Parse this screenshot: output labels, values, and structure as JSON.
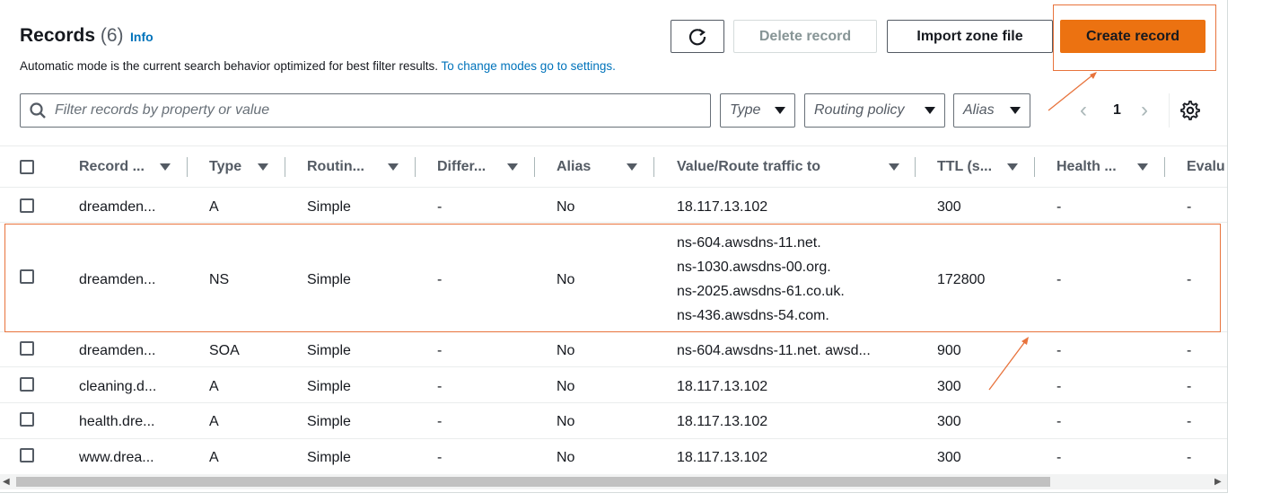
{
  "header": {
    "title": "Records",
    "count": "(6)",
    "info": "Info",
    "description": "Automatic mode is the current search behavior optimized for best filter results.",
    "settings_link": "To change modes go to settings."
  },
  "toolbar": {
    "refresh_icon": "refresh-icon",
    "delete_label": "Delete record",
    "import_label": "Import zone file",
    "create_label": "Create record"
  },
  "filters": {
    "search_placeholder": "Filter records by property or value",
    "type": "Type",
    "routing": "Routing policy",
    "alias": "Alias"
  },
  "pagination": {
    "prev": "‹",
    "page": "1",
    "next": "›"
  },
  "columns": [
    "Record ...",
    "Type",
    "Routin...",
    "Differ...",
    "Alias",
    "Value/Route traffic to",
    "TTL (s...",
    "Health ...",
    "Evalu"
  ],
  "rows": [
    {
      "name": "dreamden...",
      "type": "A",
      "routing": "Simple",
      "differ": "-",
      "alias": "No",
      "value": [
        "18.117.13.102"
      ],
      "ttl": "300",
      "health": "-",
      "eval": "-"
    },
    {
      "name": "dreamden...",
      "type": "NS",
      "routing": "Simple",
      "differ": "-",
      "alias": "No",
      "value": [
        "ns-604.awsdns-11.net.",
        "ns-1030.awsdns-00.org.",
        "ns-2025.awsdns-61.co.uk.",
        "ns-436.awsdns-54.com."
      ],
      "ttl": "172800",
      "health": "-",
      "eval": "-"
    },
    {
      "name": "dreamden...",
      "type": "SOA",
      "routing": "Simple",
      "differ": "-",
      "alias": "No",
      "value": [
        "ns-604.awsdns-11.net. awsd..."
      ],
      "ttl": "900",
      "health": "-",
      "eval": "-"
    },
    {
      "name": "cleaning.d...",
      "type": "A",
      "routing": "Simple",
      "differ": "-",
      "alias": "No",
      "value": [
        "18.117.13.102"
      ],
      "ttl": "300",
      "health": "-",
      "eval": "-"
    },
    {
      "name": "health.dre...",
      "type": "A",
      "routing": "Simple",
      "differ": "-",
      "alias": "No",
      "value": [
        "18.117.13.102"
      ],
      "ttl": "300",
      "health": "-",
      "eval": "-"
    },
    {
      "name": "www.drea...",
      "type": "A",
      "routing": "Simple",
      "differ": "-",
      "alias": "No",
      "value": [
        "18.117.13.102"
      ],
      "ttl": "300",
      "health": "-",
      "eval": "-"
    }
  ],
  "colors": {
    "accent": "#ec7211",
    "link": "#0073bb",
    "annotation": "#e8733c"
  }
}
